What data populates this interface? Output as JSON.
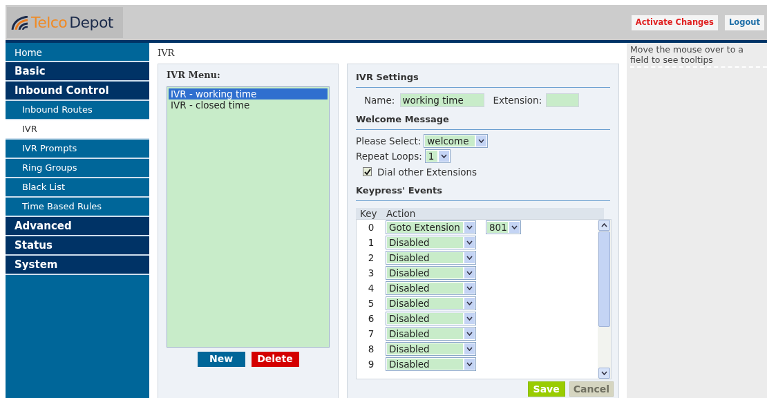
{
  "header": {
    "logo_text": [
      "Telco",
      "Depot"
    ],
    "buttons": [
      {
        "label": "Activate Changes",
        "kind": "activate"
      },
      {
        "label": "Logout",
        "kind": "logout"
      }
    ]
  },
  "sidebar": {
    "items": [
      {
        "label": "Home",
        "kind": "link",
        "selected": false
      },
      {
        "label": "Basic",
        "kind": "group",
        "selected": false
      },
      {
        "label": "Inbound Control",
        "kind": "group",
        "selected": false
      },
      {
        "label": "Inbound Routes",
        "kind": "sub",
        "selected": false
      },
      {
        "label": "IVR",
        "kind": "sub",
        "selected": true
      },
      {
        "label": "IVR Prompts",
        "kind": "sub",
        "selected": false
      },
      {
        "label": "Ring Groups",
        "kind": "sub",
        "selected": false
      },
      {
        "label": "Black List",
        "kind": "sub",
        "selected": false
      },
      {
        "label": "Time Based Rules",
        "kind": "sub",
        "selected": false
      },
      {
        "label": "Advanced",
        "kind": "group",
        "selected": false
      },
      {
        "label": "Status",
        "kind": "group",
        "selected": false
      },
      {
        "label": "System",
        "kind": "group",
        "selected": false
      }
    ]
  },
  "breadcrumb": "IVR",
  "ivr_menu": {
    "title": "IVR Menu:",
    "items": [
      {
        "label": "IVR - working time",
        "selected": true
      },
      {
        "label": "IVR - closed time",
        "selected": false
      }
    ],
    "buttons": [
      {
        "label": "New",
        "kind": "new"
      },
      {
        "label": "Delete",
        "kind": "delete"
      }
    ]
  },
  "ivr_settings": {
    "title": "IVR Settings",
    "name_label": "Name:",
    "name_value": "working time",
    "extension_label": "Extension:",
    "welcome_title": "Welcome Message",
    "select_label": "Please Select:",
    "select_value": "welcome",
    "loops_label": "Repeat Loops:",
    "loops_value": "1",
    "dial_other": {
      "label": "Dial other Extensions",
      "checked": true
    },
    "keypress_title": "Keypress' Events",
    "columns": [
      "Key",
      "Action"
    ],
    "rows": [
      {
        "key": "0",
        "action": "Goto Extension",
        "target": "801"
      },
      {
        "key": "1",
        "action": "Disabled"
      },
      {
        "key": "2",
        "action": "Disabled"
      },
      {
        "key": "3",
        "action": "Disabled"
      },
      {
        "key": "4",
        "action": "Disabled"
      },
      {
        "key": "5",
        "action": "Disabled"
      },
      {
        "key": "6",
        "action": "Disabled"
      },
      {
        "key": "7",
        "action": "Disabled"
      },
      {
        "key": "8",
        "action": "Disabled"
      },
      {
        "key": "9",
        "action": "Disabled"
      }
    ],
    "buttons": [
      {
        "label": "Save",
        "kind": "save",
        "disabled": false
      },
      {
        "label": "Cancel",
        "kind": "cancel",
        "disabled": true
      }
    ]
  },
  "tooltip_panel": "Move the mouse over to a field to see tooltips"
}
